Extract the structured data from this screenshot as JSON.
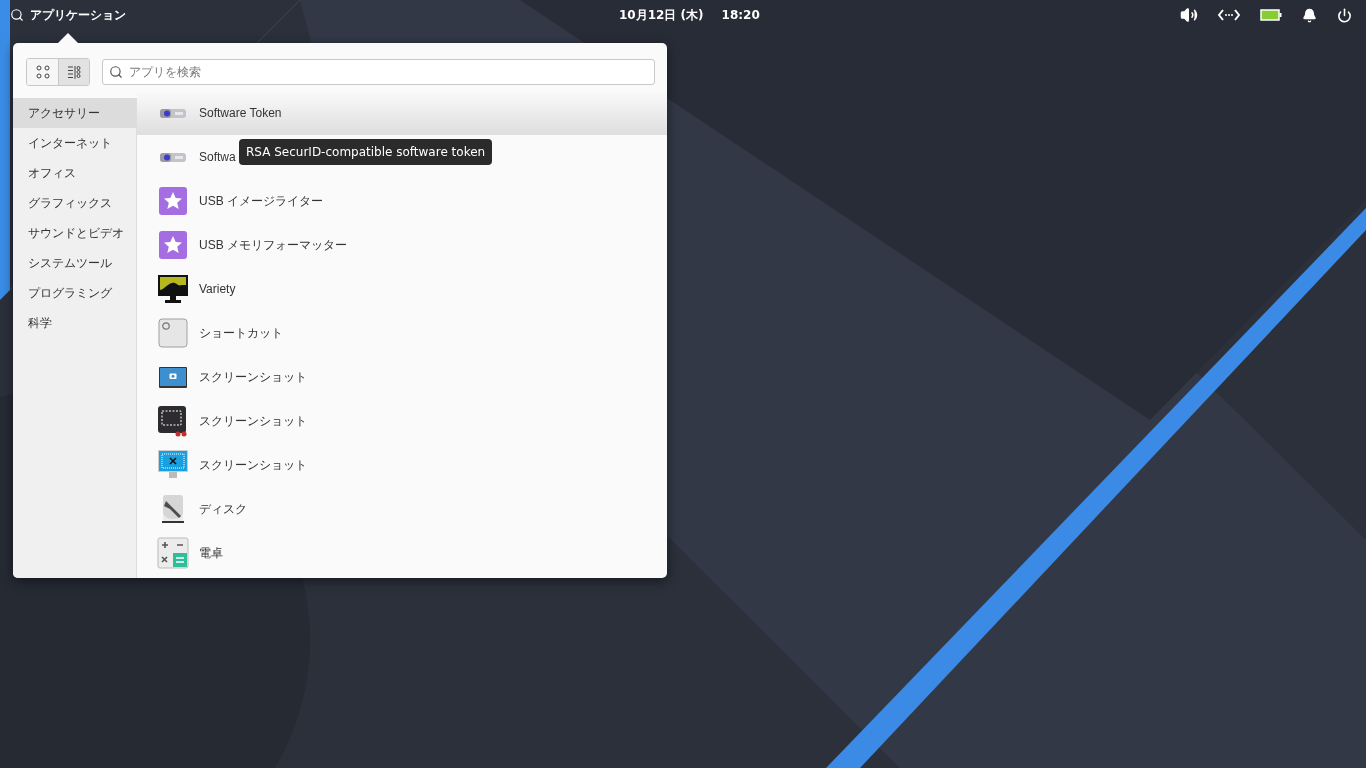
{
  "top_bar": {
    "menu_label": "アプリケーション",
    "date": "10月12日 (木)",
    "time": "18:20"
  },
  "menu": {
    "view_buttons": [
      {
        "kind": "grid",
        "selected": false
      },
      {
        "kind": "category",
        "selected": true
      }
    ],
    "search": {
      "placeholder": "アプリを検索"
    },
    "categories": [
      {
        "label": "アクセサリー",
        "selected": true
      },
      {
        "label": "インターネット",
        "selected": false
      },
      {
        "label": "オフィス",
        "selected": false
      },
      {
        "label": "グラフィックス",
        "selected": false
      },
      {
        "label": "サウンドとビデオ",
        "selected": false
      },
      {
        "label": "システムツール",
        "selected": false
      },
      {
        "label": "プログラミング",
        "selected": false
      },
      {
        "label": "科学",
        "selected": false
      }
    ],
    "apps": [
      {
        "label": "Software Token",
        "kind": "token",
        "selected": true
      },
      {
        "label": "Softwa",
        "kind": "token",
        "selected": false
      },
      {
        "label": "USB イメージライター",
        "kind": "star",
        "selected": false
      },
      {
        "label": "USB メモリフォーマッター",
        "kind": "star",
        "selected": false
      },
      {
        "label": "Variety",
        "kind": "variety",
        "selected": false
      },
      {
        "label": "ショートカット",
        "kind": "shortcut",
        "selected": false
      },
      {
        "label": "スクリーンショット",
        "kind": "camera",
        "selected": false
      },
      {
        "label": "スクリーンショット",
        "kind": "crop",
        "selected": false
      },
      {
        "label": "スクリーンショット",
        "kind": "monitor",
        "selected": false
      },
      {
        "label": "ディスク",
        "kind": "disk",
        "selected": false
      },
      {
        "label": "電卓",
        "kind": "calculator",
        "selected": false
      }
    ],
    "tooltip": "RSA SecurID-compatible software token"
  }
}
